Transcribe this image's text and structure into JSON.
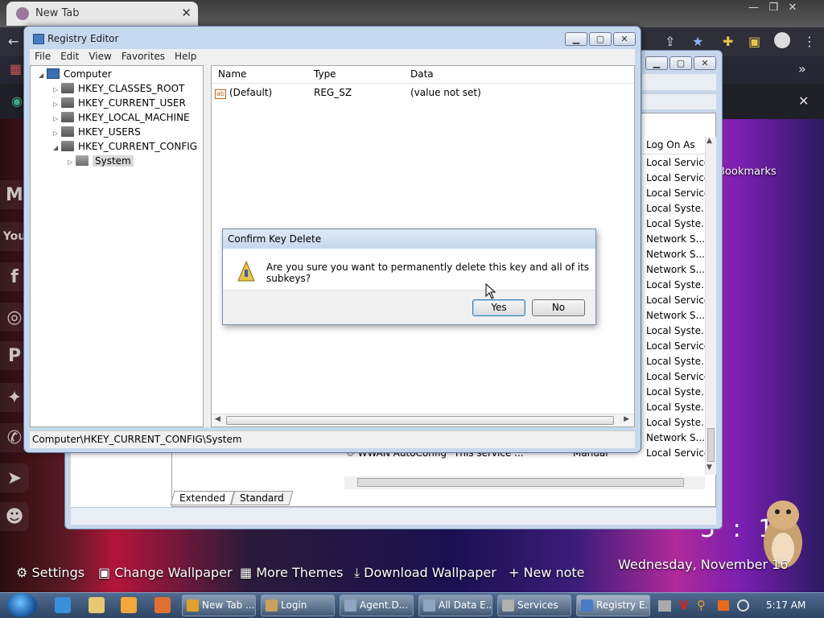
{
  "browser": {
    "tab_title": "New Tab",
    "bookmarks_label": "Bookmarks",
    "ntp": {
      "settings": "Settings",
      "change_wallpaper": "Change Wallpaper",
      "more_themes": "More Themes",
      "download_wallpaper": "Download Wallpaper",
      "new_note": "+ New note",
      "clock": "5 : 17",
      "date": "Wednesday, November 16"
    },
    "side_icons": [
      "M",
      "You",
      "f",
      "ig",
      "P",
      "tw",
      "wa",
      "tg",
      "rd"
    ]
  },
  "services": {
    "column_header": "Log On As",
    "log_on_as": [
      "Local Service",
      "Local Service",
      "Local Service",
      "Local Syste...",
      "Local Syste...",
      "Network S...",
      "Network S...",
      "Network S...",
      "Local Syste...",
      "Local Service",
      "Network S...",
      "Local Syste...",
      "Local Service",
      "Local Syste...",
      "Local Service",
      "Local Syste...",
      "Local Syste...",
      "Local Syste...",
      "Network S...",
      "Local Service"
    ],
    "last_row": {
      "name": "WWAN AutoConfig",
      "description": "This service ...",
      "startup": "Manual"
    },
    "tabs": [
      "Extended",
      "Standard"
    ]
  },
  "regedit": {
    "title": "Registry Editor",
    "menu": [
      "File",
      "Edit",
      "View",
      "Favorites",
      "Help"
    ],
    "tree": {
      "root": "Computer",
      "hives": [
        "HKEY_CLASSES_ROOT",
        "HKEY_CURRENT_USER",
        "HKEY_LOCAL_MACHINE",
        "HKEY_USERS",
        "HKEY_CURRENT_CONFIG"
      ],
      "selected_child": "System"
    },
    "columns": {
      "name": "Name",
      "type": "Type",
      "data": "Data"
    },
    "values": [
      {
        "name": "(Default)",
        "type": "REG_SZ",
        "data": "(value not set)"
      }
    ],
    "status_path": "Computer\\HKEY_CURRENT_CONFIG\\System"
  },
  "dialog": {
    "title": "Confirm Key Delete",
    "message": "Are you sure you want to permanently delete this key and all of its subkeys?",
    "yes": "Yes",
    "no": "No"
  },
  "taskbar": {
    "tasks": [
      "New Tab ...",
      "Login",
      "Agent.D...",
      "All Data E...",
      "Services",
      "Registry E..."
    ],
    "time": "5:17 AM"
  }
}
